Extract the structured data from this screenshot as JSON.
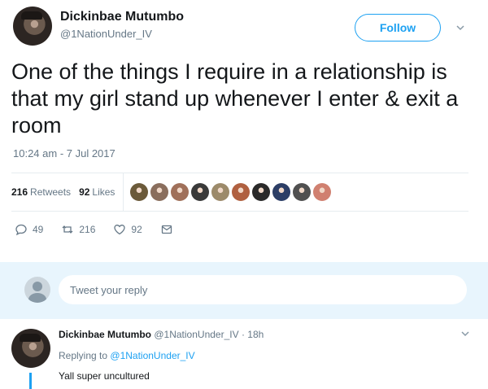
{
  "author": {
    "display_name": "Dickinbae Mutumbo",
    "handle": "@1NationUnder_IV"
  },
  "follow_button": {
    "label": "Follow"
  },
  "caret_icon": "chevron-down-icon",
  "tweet": {
    "text": "One of the things I require in a relationship is that my girl stand up whenever I enter & exit a room",
    "timestamp": "10:24 am - 7 Jul 2017"
  },
  "stats": {
    "retweets_count": "216",
    "retweets_label": "Retweets",
    "likes_count": "92",
    "likes_label": "Likes"
  },
  "likers": [
    {
      "color": "#6b5a3a"
    },
    {
      "color": "#8a6e5d"
    },
    {
      "color": "#a0705a"
    },
    {
      "color": "#3a3a3a"
    },
    {
      "color": "#9c8a6a"
    },
    {
      "color": "#b06040"
    },
    {
      "color": "#2a2a2a"
    },
    {
      "color": "#2c3e66"
    },
    {
      "color": "#505050"
    },
    {
      "color": "#d08070"
    }
  ],
  "actions": {
    "reply_count": "49",
    "retweet_count": "216",
    "like_count": "92"
  },
  "reply_box": {
    "placeholder": "Tweet your reply"
  },
  "reply": {
    "display_name": "Dickinbae Mutumbo",
    "handle": "@1NationUnder_IV",
    "time": "· 18h",
    "replying_prefix": "Replying to",
    "replying_handle": "@1NationUnder_IV",
    "text": "Yall super uncultured"
  },
  "colors": {
    "accent": "#1da1f2",
    "secondary_text": "#657786",
    "reply_bar_bg": "#e8f5fd"
  }
}
